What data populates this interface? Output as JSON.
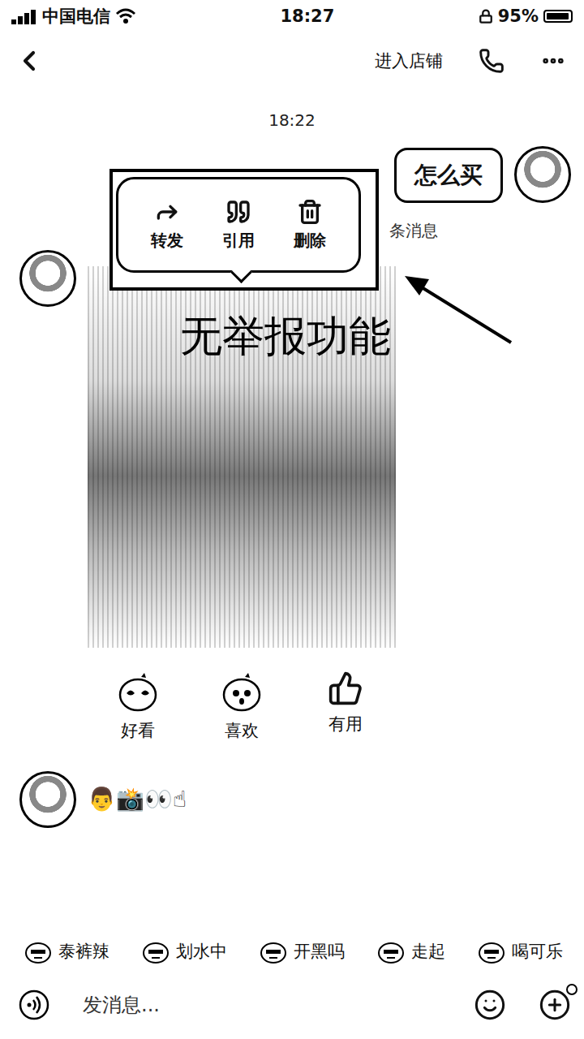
{
  "status_bar": {
    "carrier": "中国电信",
    "time": "18:27",
    "battery": "95%",
    "battery_level": 0.95
  },
  "nav": {
    "store_link": "进入店铺"
  },
  "timestamp": "18:22",
  "messages": [
    {
      "kind": "text",
      "side": "right",
      "text": "怎么买"
    },
    {
      "kind": "notice",
      "side": "center",
      "text": "条消息"
    },
    {
      "kind": "image",
      "side": "left"
    },
    {
      "kind": "emoji",
      "side": "left",
      "text": "👨📸👀☝"
    }
  ],
  "context_menu": {
    "items": [
      {
        "label": "转发"
      },
      {
        "label": "引用"
      },
      {
        "label": "删除"
      }
    ]
  },
  "annotation": {
    "text": "无举报功能"
  },
  "reactions": [
    {
      "label": "好看"
    },
    {
      "label": "喜欢"
    },
    {
      "label": "有用"
    }
  ],
  "quick_phrases": [
    {
      "label": "泰裤辣"
    },
    {
      "label": "划水中"
    },
    {
      "label": "开黑吗"
    },
    {
      "label": "走起"
    },
    {
      "label": "喝可乐"
    }
  ],
  "input": {
    "placeholder": "发消息..."
  }
}
